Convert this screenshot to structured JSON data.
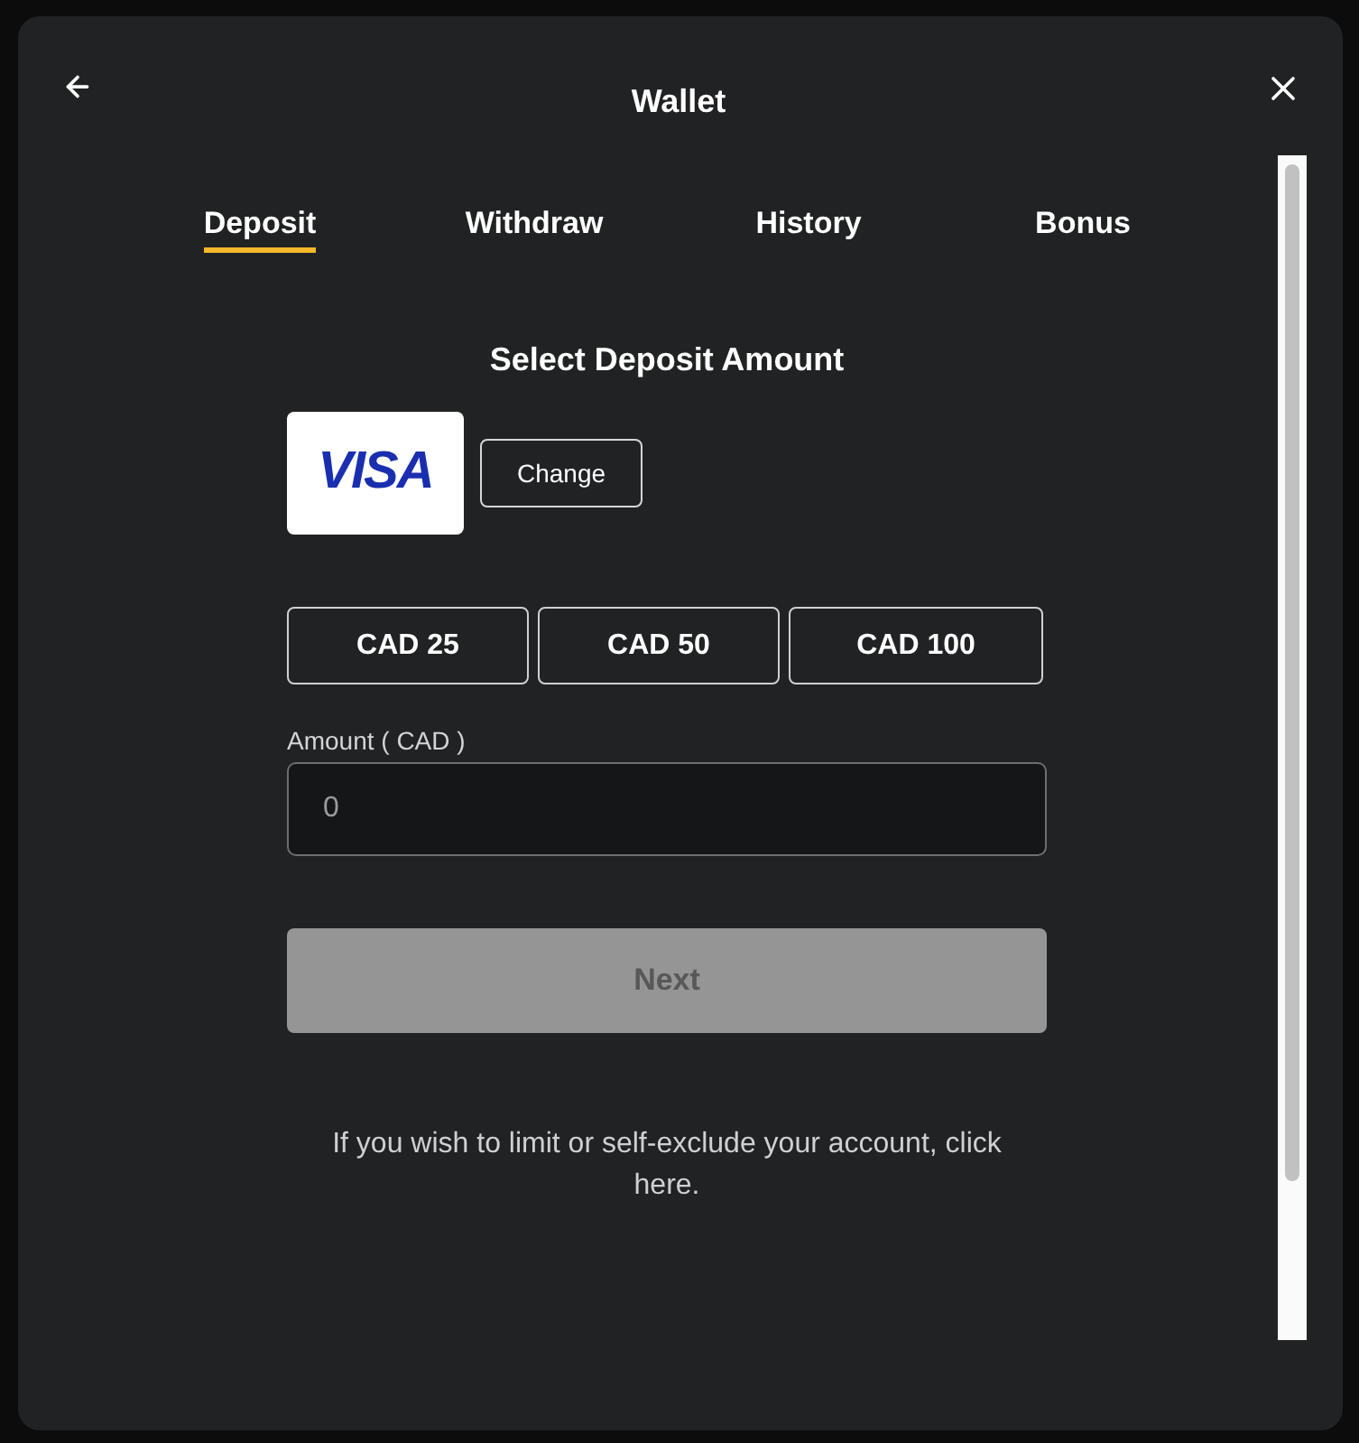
{
  "window": {
    "title": "Wallet"
  },
  "tabs": [
    {
      "label": "Deposit",
      "selected": true
    },
    {
      "label": "Withdraw",
      "selected": false
    },
    {
      "label": "History",
      "selected": false
    },
    {
      "label": "Bonus",
      "selected": false
    }
  ],
  "deposit": {
    "heading": "Select Deposit Amount",
    "card": {
      "brand": "VISA",
      "change_label": "Change"
    },
    "amount_buttons": [
      {
        "label": "CAD 25",
        "selected": false
      },
      {
        "label": "CAD 50",
        "selected": false
      },
      {
        "label": "CAD 100",
        "selected": false
      }
    ],
    "amount_field": {
      "label": "Amount ( CAD )",
      "placeholder": "0"
    },
    "next_button": {
      "label": "Next",
      "disabled": true
    },
    "footer_note": "If you wish to limit or self-exclude your account, click here."
  }
}
